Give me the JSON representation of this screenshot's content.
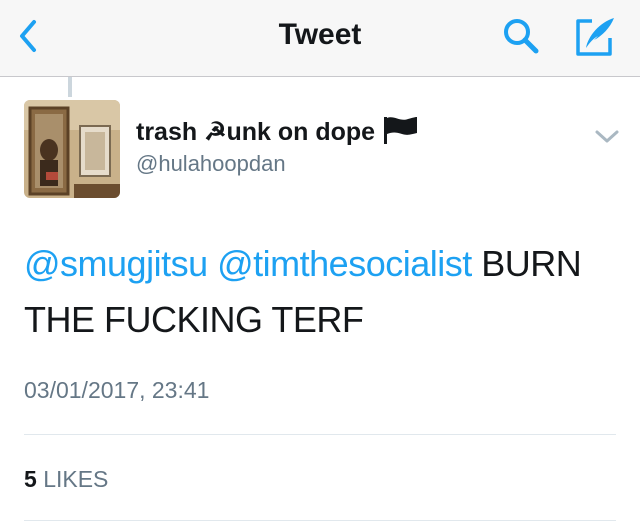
{
  "nav": {
    "title": "Tweet",
    "accent_color": "#1da1f2"
  },
  "tweet": {
    "display_name": "trash ☭unk on dope",
    "handle": "@hulahoopdan",
    "mentions": [
      "@smugjitsu",
      "@timthesocialist"
    ],
    "body": "BURN THE FUCKING TERF",
    "timestamp": "03/01/2017, 23:41",
    "likes_count": "5",
    "likes_label": "LIKES"
  },
  "icons": {
    "back": "chevron-left-icon",
    "search": "search-icon",
    "compose": "compose-icon",
    "flag": "black-flag-icon",
    "caret": "chevron-down-icon"
  }
}
